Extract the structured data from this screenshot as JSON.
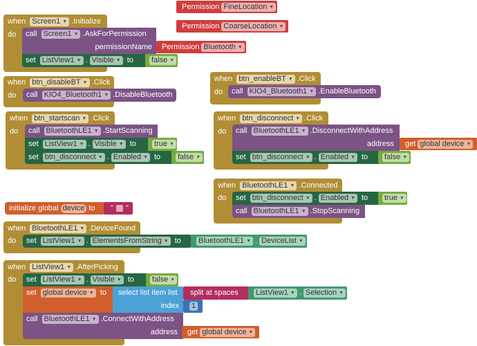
{
  "workspace": {
    "colors": {
      "event": "#b18e35",
      "procedure": "#7c5385",
      "setter": "#266643",
      "variable": "#d05f2d",
      "logic": "#77ab41",
      "permission": "#d03d3e",
      "text": "#b32d5e",
      "list": "#4ca1d7",
      "math": "#3f71b5",
      "getter": "#439970"
    },
    "kw": {
      "when": "when",
      "do": "do",
      "call": "call",
      "set": "set",
      "to": "to",
      "get": "get",
      "dot": ".",
      "permission": "Permission",
      "initialize_global": "initialize global",
      "address": "address",
      "permissionName": "permissionName",
      "index": "index",
      "select_list_item": "select list item  list",
      "split_at_spaces": "split at spaces"
    },
    "loose_permissions": [
      {
        "value": "FineLocation"
      },
      {
        "value": "CoarseLocation"
      }
    ],
    "screen_init": {
      "component": "Screen1",
      "event": ".Initialize",
      "call_component": "Screen1",
      "call_method": ".AskForPermission",
      "permission_value": "Bluetooth",
      "set_component": "ListView1",
      "set_property": "Visible",
      "set_value": "false"
    },
    "disable_bt": {
      "component": "btn_disableBT",
      "event": ".Click",
      "call_component": "KIO4_Bluetooth1",
      "call_method": ".DisableBluetooth"
    },
    "enable_bt": {
      "component": "btn_enableBT",
      "event": ".Click",
      "call_component": "KIO4_Bluetooth1",
      "call_method": ".EnableBluetooth"
    },
    "start_scan": {
      "component": "btn_startscan",
      "event": ".Click",
      "call_component": "BluetoothLE1",
      "call_method": ".StartScanning",
      "set1_component": "ListView1",
      "set1_property": "Visible",
      "set1_value": "true",
      "set2_component": "btn_disconnect",
      "set2_property": "Enabled",
      "set2_value": "false"
    },
    "disconnect": {
      "component": "btn_disconnect",
      "event": ".Click",
      "call_component": "BluetoothLE1",
      "call_method": ".DisconnectWithAddress",
      "address_var": "global device",
      "set_component": "btn_disconnect",
      "set_property": "Enabled",
      "set_value": "false"
    },
    "connected": {
      "component": "BluetoothLE1",
      "event": ".Connected",
      "set_component": "btn_disconnect",
      "set_property": "Enabled",
      "set_value": "true",
      "call_component": "BluetoothLE1",
      "call_method": ".StopScanning"
    },
    "global_var": {
      "name": "device",
      "open_quote": "\"",
      "close_quote": "\""
    },
    "device_found": {
      "component": "BluetoothLE1",
      "event": ".DeviceFound",
      "set_component": "ListView1",
      "set_property": "ElementsFromString",
      "get_component": "BluetoothLE1",
      "get_property": "DeviceList"
    },
    "after_picking": {
      "component": "ListView1",
      "event": ".AfterPicking",
      "set_component": "ListView1",
      "set_property": "Visible",
      "set_value": "false",
      "var_name": "global device",
      "sel_component": "ListView1",
      "sel_property": "Selection",
      "index_value": "1",
      "call_component": "BluetoothLE1",
      "call_method": ".ConnectWithAddress",
      "address_var": "global device"
    }
  }
}
